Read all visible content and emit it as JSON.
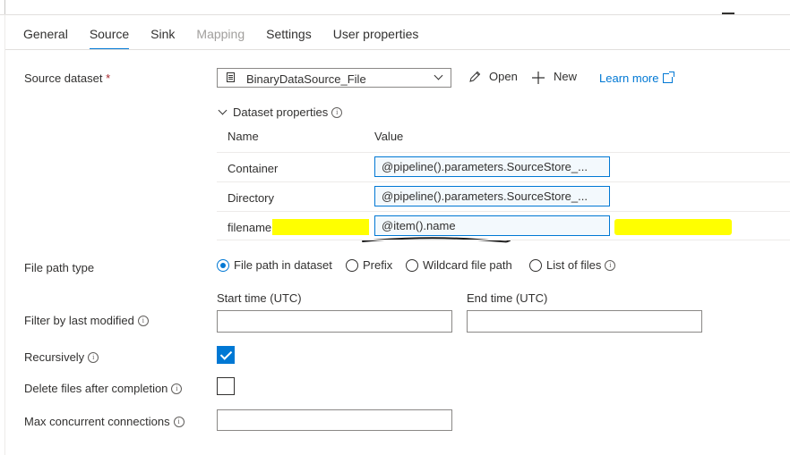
{
  "tabs": [
    {
      "label": "General"
    },
    {
      "label": "Source"
    },
    {
      "label": "Sink"
    },
    {
      "label": "Mapping"
    },
    {
      "label": "Settings"
    },
    {
      "label": "User properties"
    }
  ],
  "source_dataset": {
    "label": "Source dataset",
    "required_mark": "*",
    "selected": "BinaryDataSource_File",
    "open_label": "Open",
    "new_label": "New",
    "learn_more": "Learn more"
  },
  "dataset_properties": {
    "title": "Dataset properties",
    "col_name": "Name",
    "col_value": "Value",
    "rows": [
      {
        "name": "Container",
        "value": "@pipeline().parameters.SourceStore_..."
      },
      {
        "name": "Directory",
        "value": "@pipeline().parameters.SourceStore_..."
      },
      {
        "name": "filename",
        "value": "@item().name"
      }
    ]
  },
  "file_path_type": {
    "label": "File path type",
    "options": [
      "File path in dataset",
      "Prefix",
      "Wildcard file path",
      "List of files"
    ],
    "selected": "File path in dataset"
  },
  "filter": {
    "label": "Filter by last modified",
    "start_label": "Start time (UTC)",
    "end_label": "End time (UTC)",
    "start_value": "",
    "end_value": ""
  },
  "recursively": {
    "label": "Recursively",
    "checked": true
  },
  "delete_after": {
    "label": "Delete files after completion",
    "checked": false
  },
  "max_connections": {
    "label": "Max concurrent connections",
    "value": ""
  },
  "colors": {
    "accent": "#0078d4",
    "highlight": "#ffff00",
    "required": "#a4262c"
  }
}
